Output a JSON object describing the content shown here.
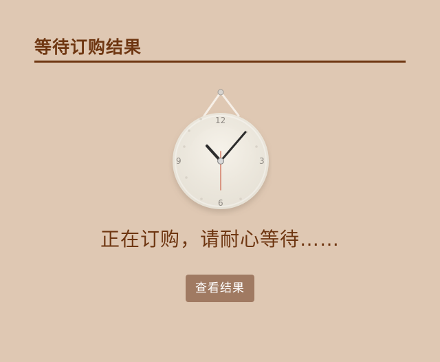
{
  "header": {
    "title": "等待订购结果"
  },
  "clock": {
    "icon": "wall-clock-icon",
    "numbers": {
      "twelve": "12",
      "three": "3",
      "six": "6",
      "nine": "9"
    }
  },
  "status": {
    "message": "正在订购，请耐心等待……"
  },
  "actions": {
    "view_result_label": "查看结果"
  },
  "colors": {
    "background": "#dfc8b3",
    "title": "#6e3611",
    "button": "#a07a62",
    "button_text": "#ffffff"
  }
}
